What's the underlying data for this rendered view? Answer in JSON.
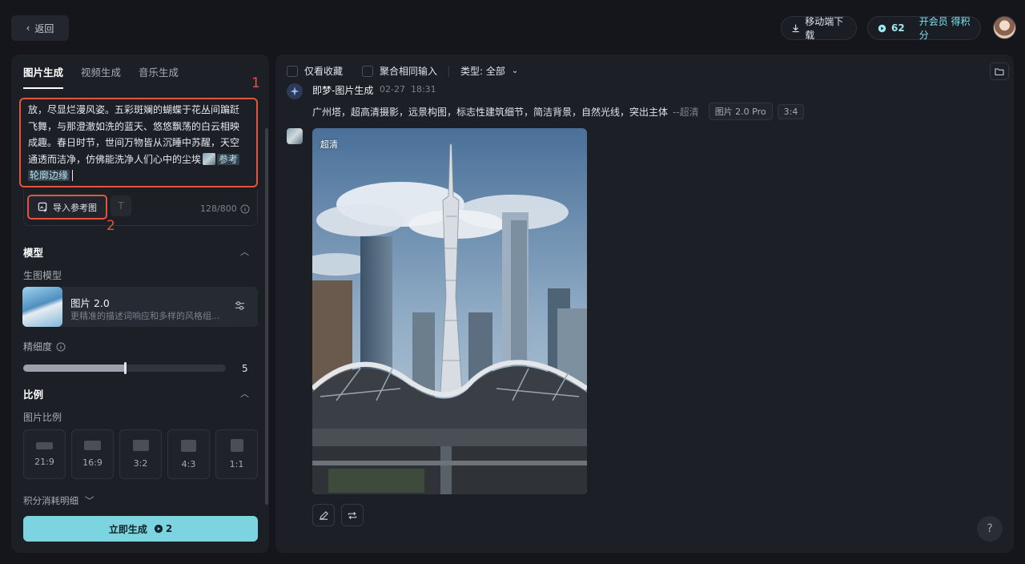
{
  "header": {
    "back_label": "返回",
    "download_label": "移动端下载",
    "credits": "62",
    "vip_label": "开会员 得积分"
  },
  "left": {
    "tabs": [
      "图片生成",
      "视频生成",
      "音乐生成"
    ],
    "prompt": {
      "line1": "放，尽显烂漫风姿。五彩斑斓的蝴蝶于花丛间蹁跹",
      "line2": "飞舞，与那澄澈如洗的蓝天、悠悠飘荡的白云相映",
      "line3": "成趣。春日时节，世间万物皆从沉睡中苏醒，天空",
      "line4": "通透而洁净，仿佛能洗净人们心中的尘埃",
      "ref_tag1": "参考",
      "ref_tag2": "轮廓边缘"
    },
    "import_label": "导入参考图",
    "text_btn_label": "T",
    "counter": "128/800",
    "annotation1": "1",
    "annotation2": "2",
    "model_section": "模型",
    "model_sublabel": "生图模型",
    "model_name": "图片 2.0",
    "model_desc": "更精准的描述词响应和多样的风格组...",
    "fineness_label": "精细度",
    "fineness_value": "5",
    "fineness_fraction": 0.5,
    "ratio_section": "比例",
    "ratio_sublabel": "图片比例",
    "ratios": [
      "21:9",
      "16:9",
      "3:2",
      "4:3",
      "1:1"
    ],
    "cost_detail": "积分消耗明细",
    "generate_label": "立即生成",
    "generate_cost": "2"
  },
  "right": {
    "filter_favorites": "仅看收藏",
    "filter_merge": "聚合相同输入",
    "filter_type": "类型: 全部",
    "bot_name": "即梦-图片生成",
    "date": "02-27",
    "time": "18:31",
    "prompt_text": "广州塔，超高清摄影，远景构图，标志性建筑细节，简洁背景，自然光线，突出主体",
    "prompt_suffix": "--超清",
    "chip_model": "图片 2.0 Pro",
    "chip_ratio": "3:4",
    "image_tag": "超清",
    "help": "?"
  }
}
